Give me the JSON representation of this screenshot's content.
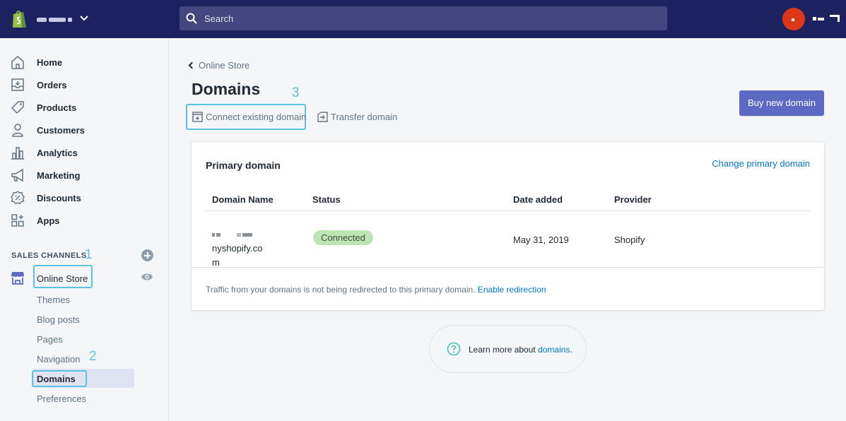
{
  "topbar": {
    "search_placeholder": "Search"
  },
  "sidebar": {
    "items": [
      {
        "label": "Home",
        "icon": "home-icon"
      },
      {
        "label": "Orders",
        "icon": "orders-icon"
      },
      {
        "label": "Products",
        "icon": "tag-icon"
      },
      {
        "label": "Customers",
        "icon": "person-icon"
      },
      {
        "label": "Analytics",
        "icon": "bar-chart-icon"
      },
      {
        "label": "Marketing",
        "icon": "megaphone-icon"
      },
      {
        "label": "Discounts",
        "icon": "discount-icon"
      },
      {
        "label": "Apps",
        "icon": "apps-icon"
      }
    ],
    "sales_channels_heading": "SALES CHANNELS",
    "online_store_label": "Online Store",
    "sub_items": [
      "Themes",
      "Blog posts",
      "Pages",
      "Navigation",
      "Domains",
      "Preferences"
    ],
    "active_sub_item": "Domains"
  },
  "annotations": {
    "one": "1",
    "two": "2",
    "three": "3"
  },
  "main": {
    "breadcrumb": "Online Store",
    "title": "Domains",
    "connect_label": "Connect existing domain",
    "transfer_label": "Transfer domain",
    "buy_label": "Buy new domain",
    "card": {
      "title": "Primary domain",
      "change_link": "Change primary domain",
      "columns": [
        "Domain Name",
        "Status",
        "Date added",
        "Provider"
      ],
      "row": {
        "domain_suffix": "nyshopify.co",
        "domain_wrap": "m",
        "status": "Connected",
        "date_added": "May 31, 2019",
        "provider": "Shopify"
      },
      "footer_text": "Traffic from your domains is not being redirected to this primary domain.",
      "footer_link": "Enable redirection"
    },
    "learn_text": "Learn more about",
    "learn_link": "domains",
    "learn_end": "."
  },
  "colors": {
    "topbar": "#1c2260",
    "accent": "#5c6ac4",
    "link": "#007ace",
    "annotation": "#5bc2e7",
    "badge_bg": "#bbe5b3"
  }
}
